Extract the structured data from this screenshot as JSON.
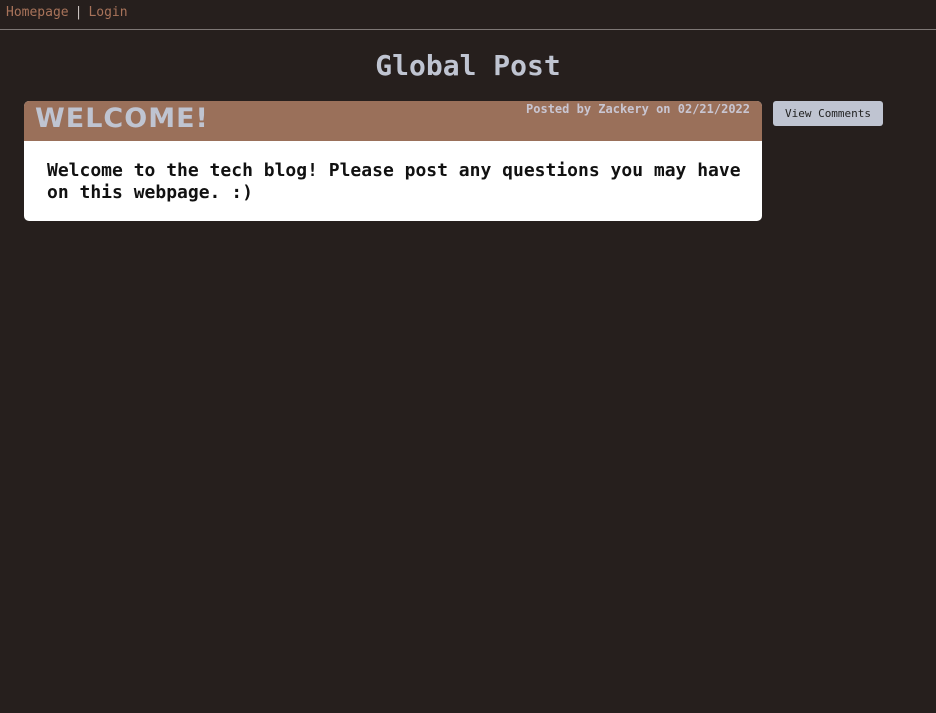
{
  "nav": {
    "homepage_label": "Homepage",
    "separator": "|",
    "login_label": "Login"
  },
  "page": {
    "title": "Global Post"
  },
  "post": {
    "title": "WELCOME!",
    "meta": "Posted by Zackery on 02/21/2022",
    "body": "Welcome to the tech blog! Please post any questions you may have on this webpage. :)",
    "view_comments_label": "View Comments"
  },
  "colors": {
    "background": "#261f1d",
    "nav_link": "#a8735a",
    "header_bar": "#9a705a",
    "title_text": "#bfc4d1",
    "button_bg": "#bfc4d1"
  }
}
